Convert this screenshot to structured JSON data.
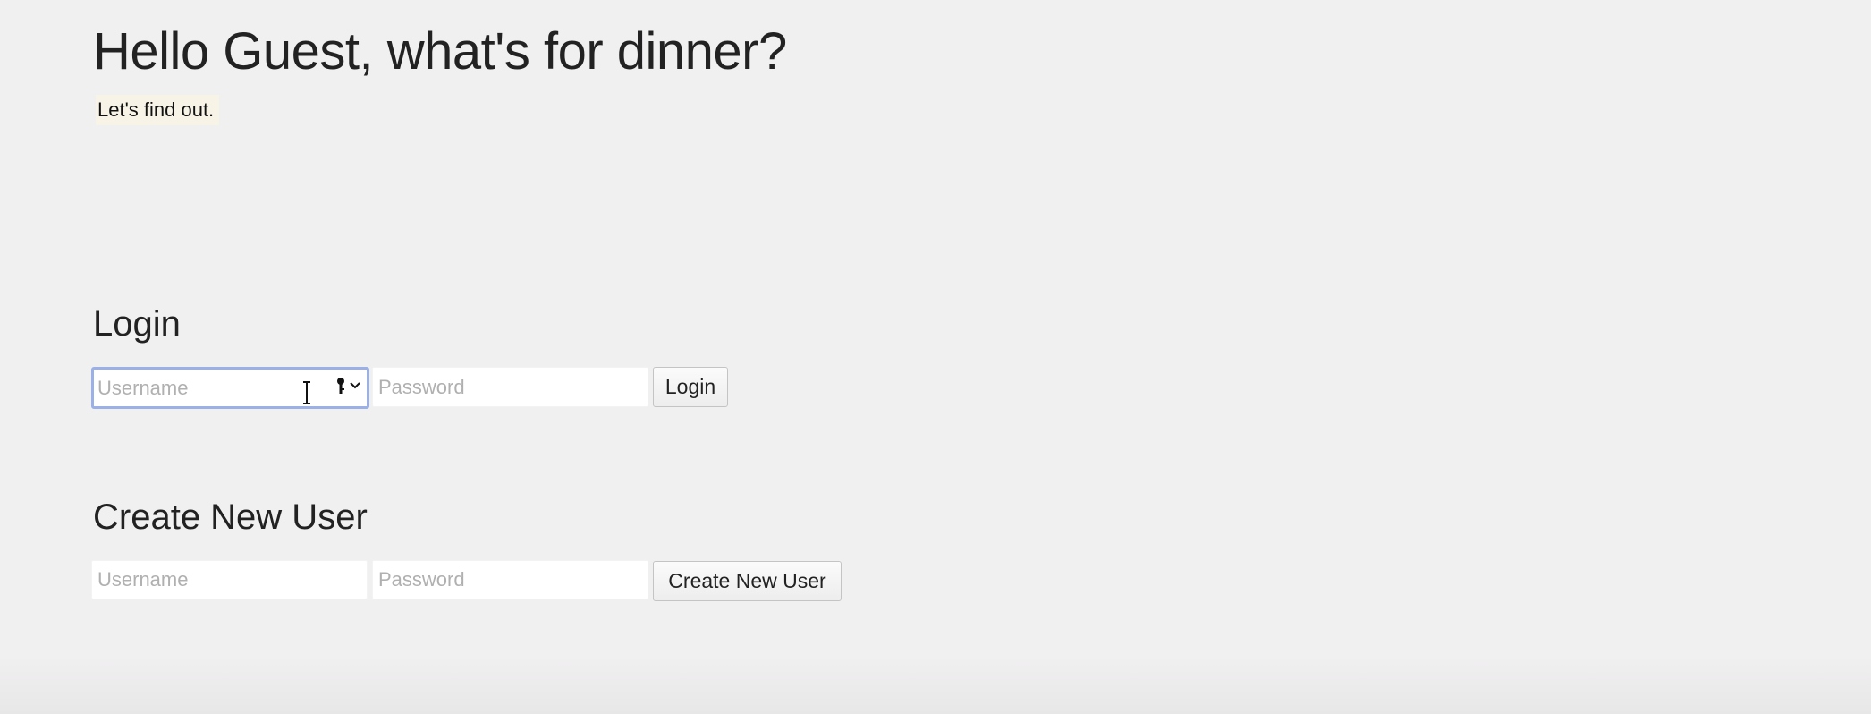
{
  "header": {
    "title": "Hello Guest, what's for dinner?",
    "subtitle": "Let's find out."
  },
  "login": {
    "title": "Login",
    "username_placeholder": "Username",
    "password_placeholder": "Password",
    "button_label": "Login",
    "username_value": "",
    "password_value": ""
  },
  "create_user": {
    "title": "Create New User",
    "username_placeholder": "Username",
    "password_placeholder": "Password",
    "button_label": "Create New User",
    "username_value": "",
    "password_value": ""
  },
  "icons": {
    "password_manager": "key-icon",
    "text_cursor": "text-cursor-icon"
  },
  "colors": {
    "background": "#f1f0f1",
    "focus_ring": "#9cb0e8",
    "subtitle_highlight": "#f7f4e7",
    "placeholder": "#b0b0b0"
  }
}
